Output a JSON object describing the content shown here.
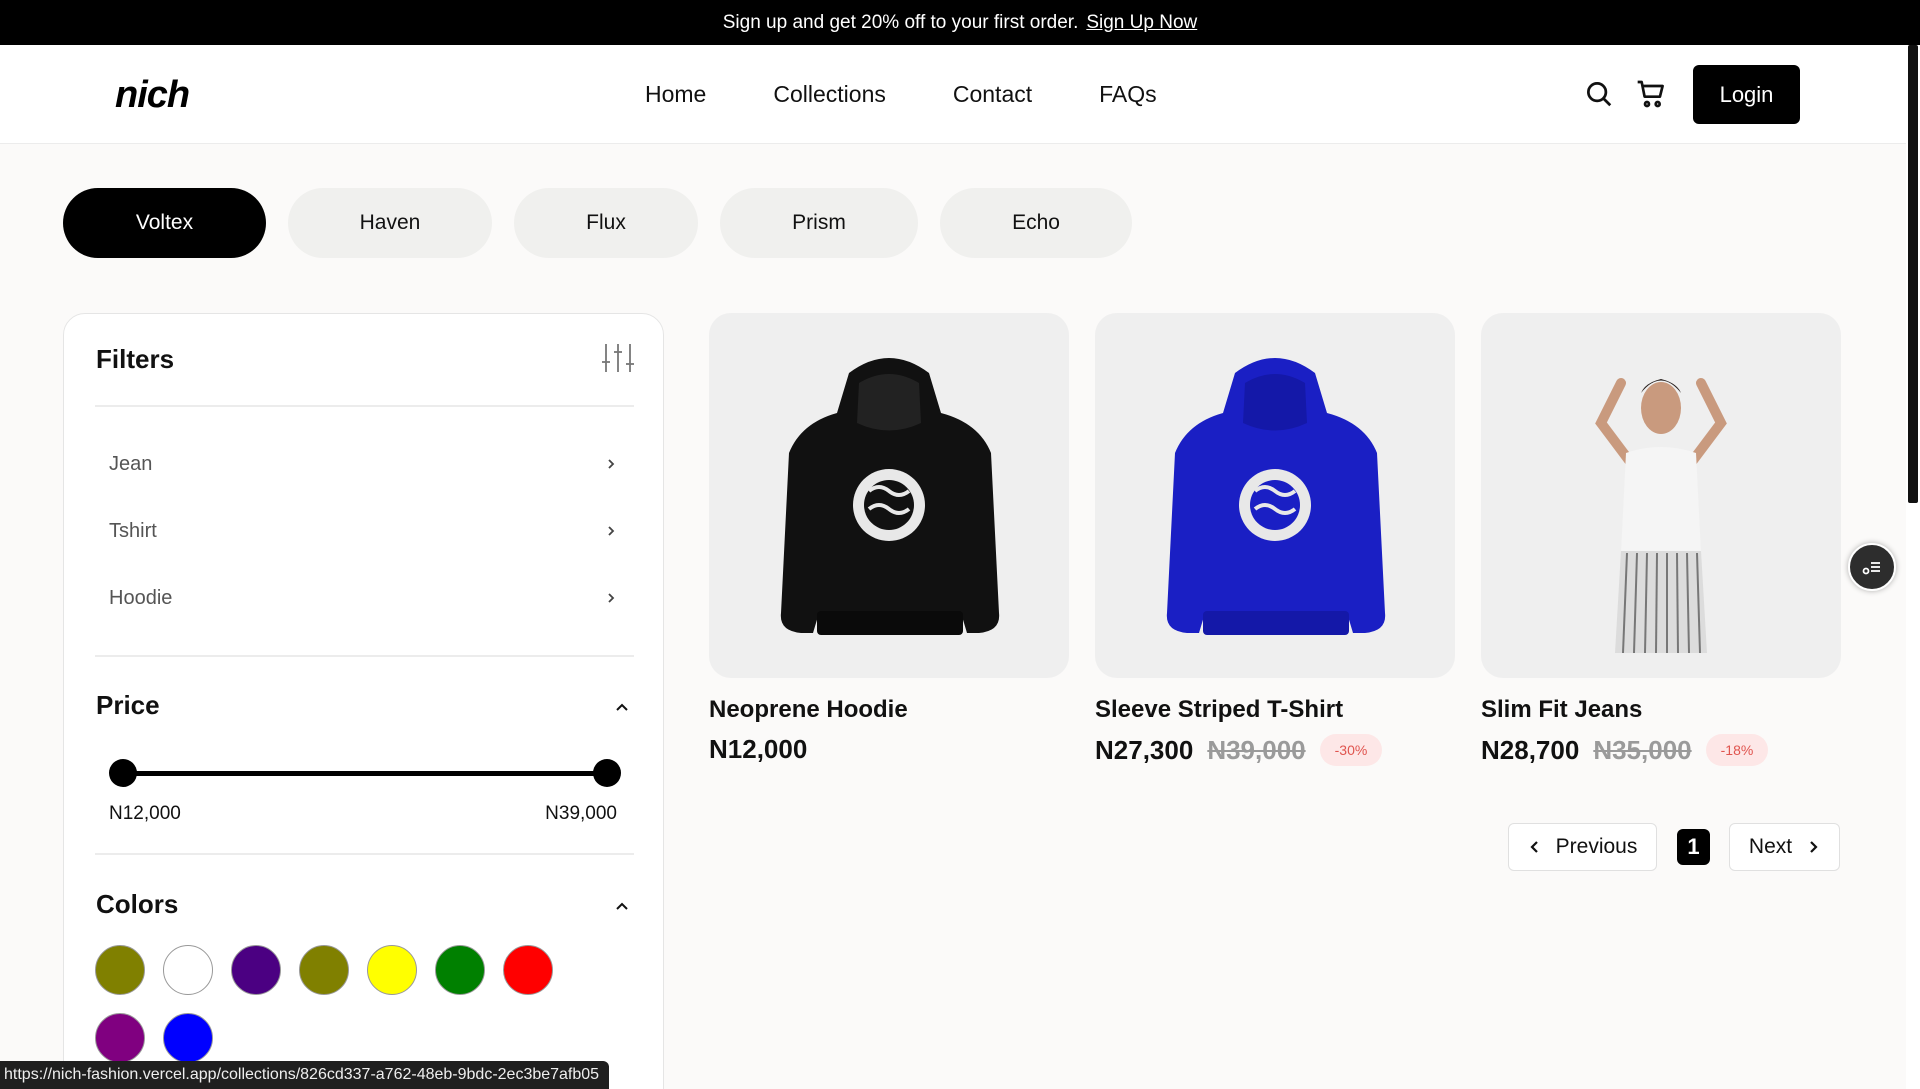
{
  "promo": {
    "text": "Sign up and get 20% off to your first order.",
    "link": "Sign Up Now"
  },
  "header": {
    "logo_text": "nich",
    "nav": [
      "Home",
      "Collections",
      "Contact",
      "FAQs"
    ],
    "login_label": "Login"
  },
  "collections": [
    {
      "label": "Voltex",
      "active": true
    },
    {
      "label": "Haven",
      "active": false
    },
    {
      "label": "Flux",
      "active": false
    },
    {
      "label": "Prism",
      "active": false
    },
    {
      "label": "Echo",
      "active": false
    }
  ],
  "filters": {
    "title": "Filters",
    "categories": [
      "Jean",
      "Tshirt",
      "Hoodie"
    ],
    "price": {
      "title": "Price",
      "min_label": "N12,000",
      "max_label": "N39,000",
      "min_fraction": 0,
      "max_fraction": 1
    },
    "colors": {
      "title": "Colors",
      "swatches": [
        "#808000",
        "#ffffff",
        "#4b0082",
        "#808000",
        "#ffff00",
        "#008000",
        "#ff0000",
        "#800080",
        "#0000ff"
      ]
    }
  },
  "products": [
    {
      "name": "Neoprene Hoodie",
      "price": "N12,000",
      "old_price": "",
      "discount": "",
      "image": "black-hoodie"
    },
    {
      "name": "Sleeve Striped T-Shirt",
      "price": "N27,300",
      "old_price": "N39,000",
      "discount": "-30%",
      "image": "blue-hoodie"
    },
    {
      "name": "Slim Fit Jeans",
      "price": "N28,700",
      "old_price": "N35,000",
      "discount": "-18%",
      "image": "model-striped-pants"
    }
  ],
  "pagination": {
    "previous": "Previous",
    "current": "1",
    "next": "Next"
  },
  "status_url": "https://nich-fashion.vercel.app/collections/826cd337-a762-48eb-9bdc-2ec3be7afb05"
}
